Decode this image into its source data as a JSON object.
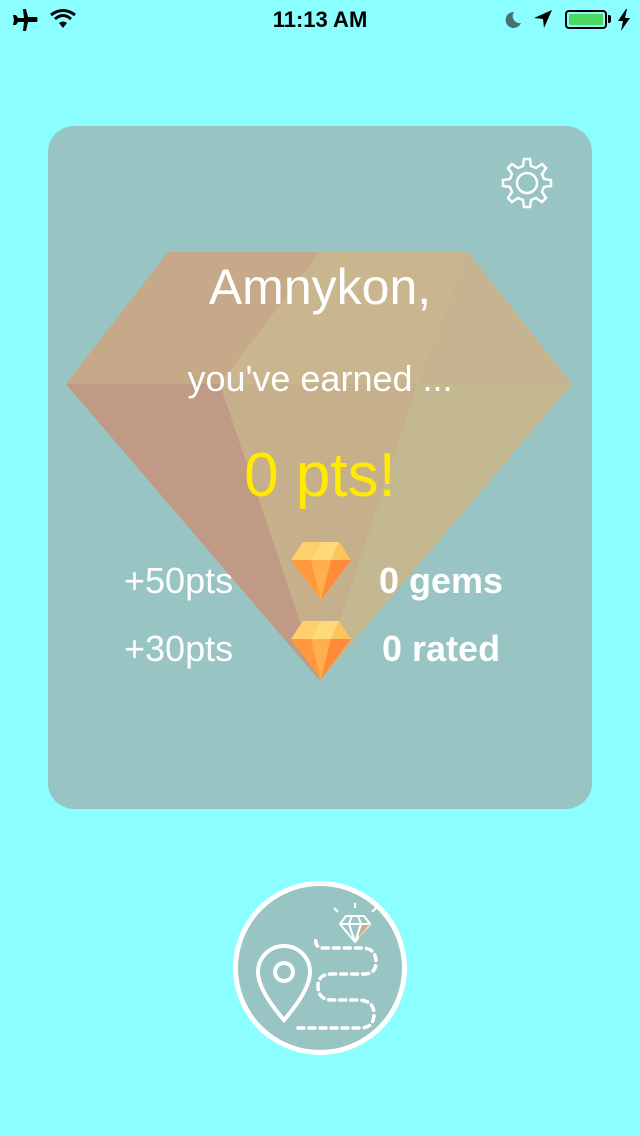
{
  "status_bar": {
    "time": "11:13 AM",
    "left_icons": [
      "airplane-icon",
      "wifi-icon"
    ],
    "right_icons": [
      "moon-icon",
      "location-arrow-icon",
      "battery-icon",
      "charging-bolt-icon"
    ],
    "battery_color": "#4cd964"
  },
  "card": {
    "background_color": "#98c4c3",
    "user_name": "Amnykon,",
    "earned_text": "you've earned ...",
    "points_total": "0 pts!",
    "points_color": "#ffea00",
    "settings_icon": "gear-icon",
    "rewards": [
      {
        "points": "+50pts",
        "icon": "gem-icon",
        "count": "0 gems"
      },
      {
        "points": "+30pts",
        "icon": "gem-icon",
        "count": "0 rated"
      }
    ]
  },
  "map_button": {
    "icon": "treasure-route-icon"
  },
  "colors": {
    "background": "#8bffff",
    "text": "#ffffff"
  }
}
